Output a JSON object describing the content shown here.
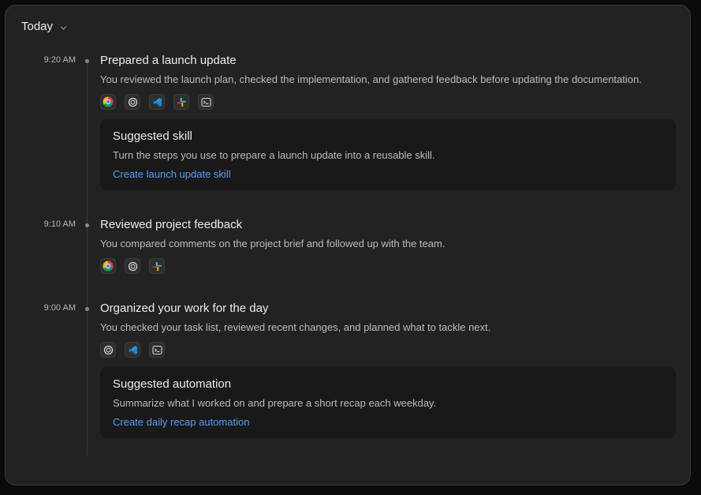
{
  "header": {
    "title": "Today"
  },
  "entries": [
    {
      "time": "9:20 AM",
      "title": "Prepared a launch update",
      "description": "You reviewed the launch plan, checked the implementation, and gathered feedback before updating the documentation.",
      "apps": [
        "chrome-icon",
        "chatgpt-icon",
        "vscode-icon",
        "slack-icon",
        "terminal-icon"
      ],
      "card": {
        "title": "Suggested skill",
        "description": "Turn the steps you use to prepare a launch update into a reusable skill.",
        "link": "Create launch update skill"
      }
    },
    {
      "time": "9:10 AM",
      "title": "Reviewed project feedback",
      "description": "You compared comments on the project brief and followed up with the team.",
      "apps": [
        "chrome-icon",
        "chatgpt-icon",
        "slack-icon"
      ]
    },
    {
      "time": "9:00 AM",
      "title": "Organized your work for the day",
      "description": "You checked your task list, reviewed recent changes, and planned what to tackle next.",
      "apps": [
        "chatgpt-icon",
        "vscode-icon",
        "terminal-icon"
      ],
      "card": {
        "title": "Suggested automation",
        "description": "Summarize what I worked on and prepare a short recap each weekday.",
        "link": "Create daily recap automation"
      }
    }
  ],
  "colors": {
    "background": "#222222",
    "card": "#191919",
    "link": "#5b9cf2",
    "text": "#ececec",
    "muted": "#bcbcbc"
  }
}
